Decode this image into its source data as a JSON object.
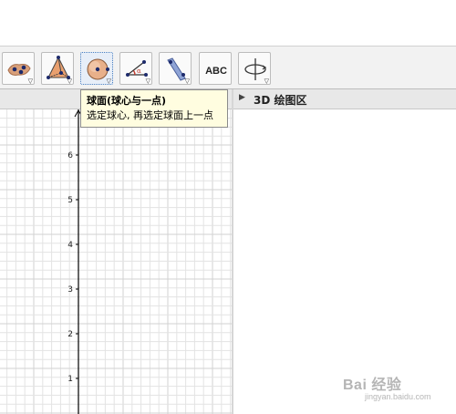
{
  "toolbar": {
    "tools": [
      {
        "name": "polyhedron-tool",
        "icon": "surface-points-icon"
      },
      {
        "name": "pyramid-tool",
        "icon": "pyramid-icon"
      },
      {
        "name": "sphere-tool",
        "icon": "sphere-icon",
        "selected": true
      },
      {
        "name": "angle-tool",
        "icon": "angle-icon"
      },
      {
        "name": "plane-tool",
        "icon": "plane-icon"
      },
      {
        "name": "text-tool",
        "icon": "text-icon",
        "label": "ABC"
      },
      {
        "name": "rotate-view-tool",
        "icon": "rotate-view-icon"
      }
    ]
  },
  "tooltip": {
    "title": "球面(球心与一点)",
    "description": "选定球心, 再选定球面上一点"
  },
  "view3d": {
    "title": "3D 绘图区"
  },
  "graphics": {
    "y_ticks": [
      "1",
      "2",
      "3",
      "4",
      "5",
      "6"
    ]
  },
  "watermark": {
    "brand": "Bai 经验",
    "url": "jingyan.baidu.com"
  },
  "colors": {
    "grid": "#e3e3e3",
    "axis": "#000000",
    "tooltip_bg": "#fffde0",
    "selected_tool": "#e7eef8"
  }
}
